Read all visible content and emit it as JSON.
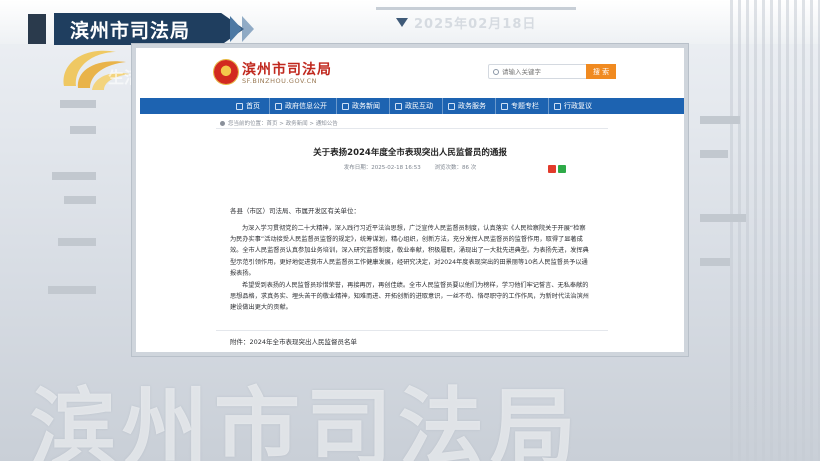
{
  "broadcast": {
    "channel_title": "滨州市司法局",
    "date_text": "2025年02月18日",
    "ghost_title": "滨州市司法局"
  },
  "site": {
    "name": "滨州市司法局",
    "domain": "SF.BINZHOU.GOV.CN",
    "search_placeholder": "请输入关键字",
    "search_button": "搜 索",
    "nav": [
      {
        "label": "首页",
        "icon": "home-icon"
      },
      {
        "label": "政府信息公开",
        "icon": "info-icon"
      },
      {
        "label": "政务新闻",
        "icon": "news-icon"
      },
      {
        "label": "政民互动",
        "icon": "chat-icon"
      },
      {
        "label": "政务服务",
        "icon": "service-icon"
      },
      {
        "label": "专题专栏",
        "icon": "topic-icon"
      },
      {
        "label": "行政复议",
        "icon": "review-icon"
      }
    ],
    "breadcrumb": "您当前的位置：首页 > 政务新闻 > 通知公告"
  },
  "article": {
    "title": "关于表扬2024年度全市表现突出人民监督员的通报",
    "published": "发布日期：2025-02-18 16:53",
    "views": "浏览次数：86 次",
    "salutation": "各县（市区）司法局、市属开发区有关单位：",
    "paragraph1": "为深入学习贯彻党的二十大精神，深入践行习近平法治思想，广泛宣传人民监督员制度，认真落实《人民检察院关于开展“检察为民办实事”活动接受人民监督员监督的规定》，统筹谋划，精心组织，创新方法，充分发挥人民监督员的监督作用，取得了显著成效。全市人民监督员认真参加业务培训，深入研究监督制度，敬业奉献，积极履职，涌现出了一大批先进典型。为表扬先进，发挥典型示范引领作用，更好地促进我市人民监督员工作健康发展，经研究决定，对2024年度表现突出的田景丽等10名人民监督员予以通报表扬。",
    "paragraph2": "希望受到表扬的人民监督员珍惜荣誉，再接再厉，再创佳绩。全市人民监督员要以他们为榜样，学习他们牢记誓言、无私奉献的思想品格，求真务实、埋头苦干的敬业精神，知难而进、开拓创新的进取意识，一丝不苟、恪尽职守的工作作风，为新时代法治滨州建设做出更大的贡献。",
    "attachment": "附件：2024年全市表现突出人民监督员名单"
  }
}
